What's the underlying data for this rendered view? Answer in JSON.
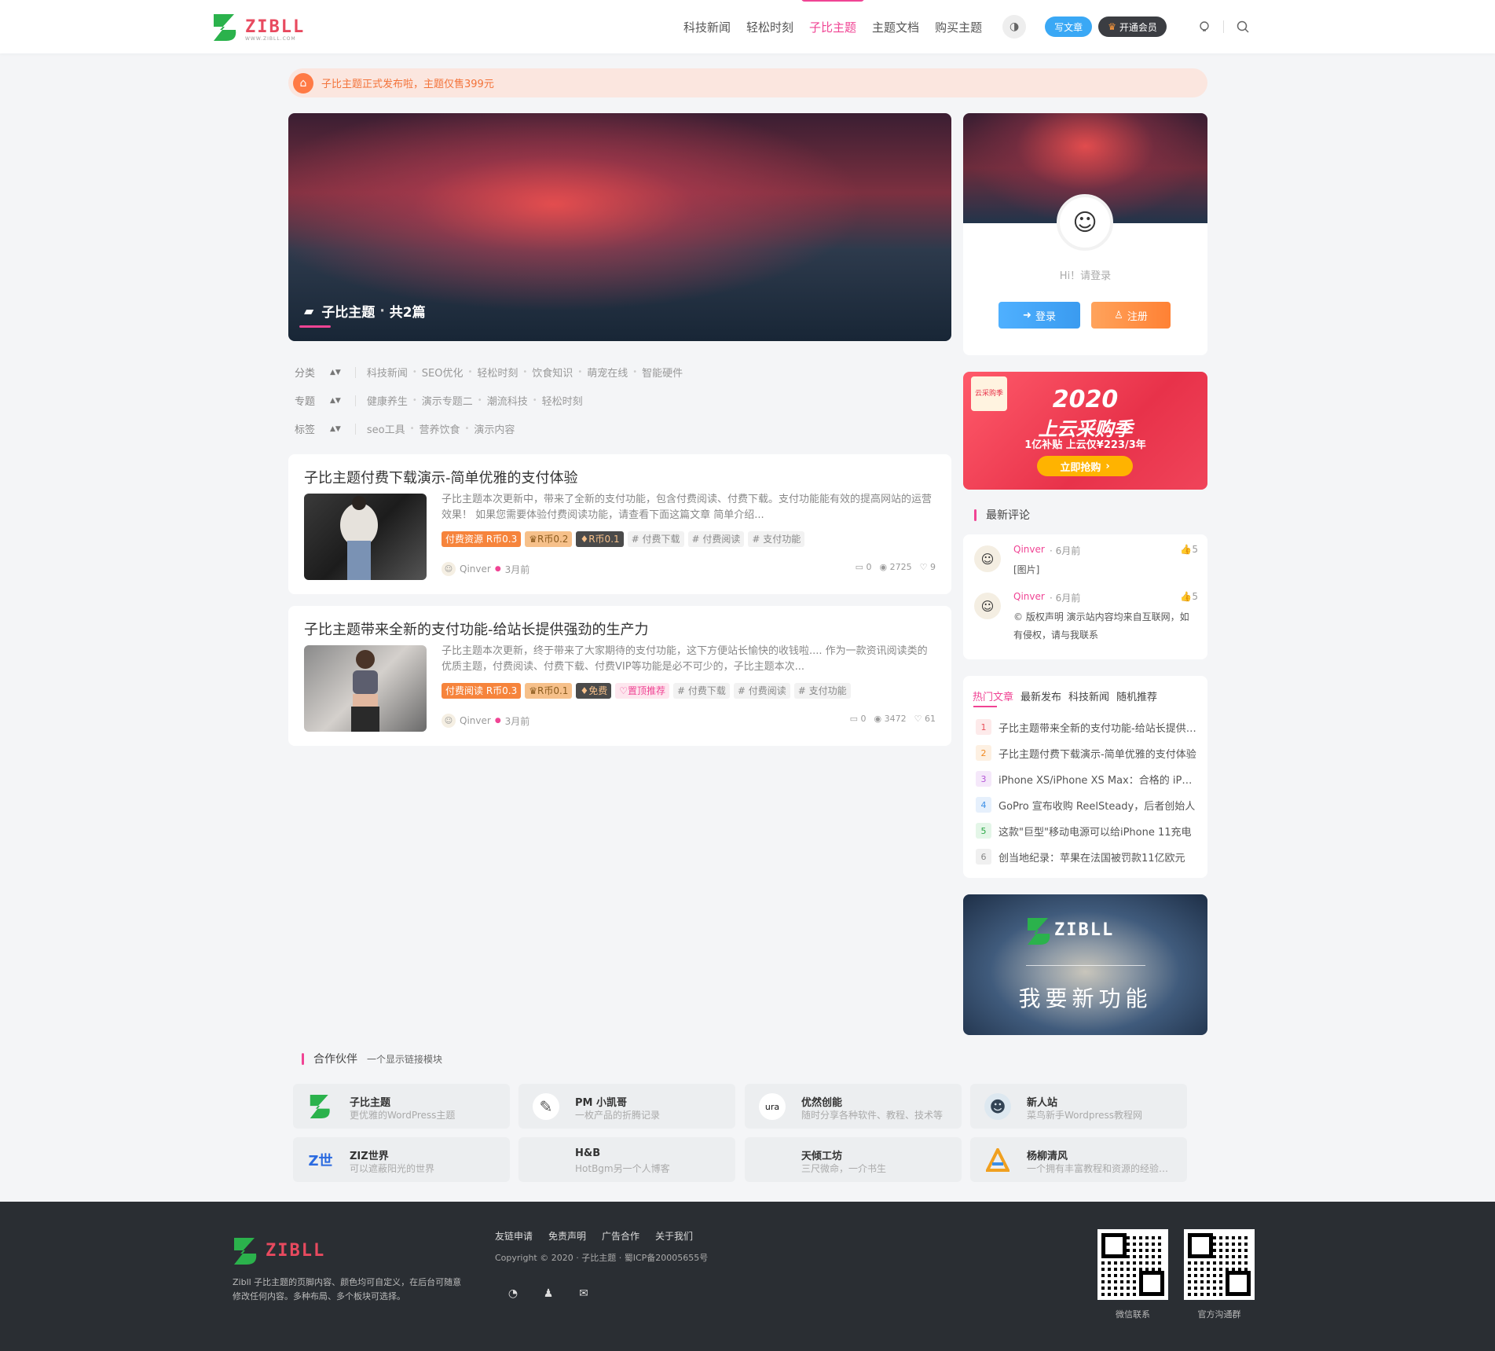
{
  "header": {
    "logo_text": "ZIBLL",
    "logo_sub": "WWW.ZIBLL.COM",
    "nav": [
      "科技新闻",
      "轻松时刻",
      "子比主题",
      "主题文档",
      "购买主题"
    ],
    "write_label": "写文章",
    "vip_label": "开通会员"
  },
  "notice": {
    "text": "子比主题正式发布啦，主题仅售399元"
  },
  "hero": {
    "category": "子比主题",
    "count": "共2篇"
  },
  "filters": [
    {
      "label": "分类",
      "items": [
        "科技新闻",
        "SEO优化",
        "轻松时刻",
        "饮食知识",
        "萌宠在线",
        "智能硬件"
      ]
    },
    {
      "label": "专题",
      "items": [
        "健康养生",
        "演示专题二",
        "潮流科技",
        "轻松时刻"
      ]
    },
    {
      "label": "标签",
      "items": [
        "seo工具",
        "营养饮食",
        "演示内容"
      ]
    }
  ],
  "posts": [
    {
      "title": "子比主题付费下载演示-简单优雅的支付体验",
      "desc": "子比主题本次更新中，带来了全新的支付功能，包含付费阅读、付费下载。支付功能能有效的提高网站的运营效果！ 如果您需要体验付费阅读功能，请查看下面这篇文章 简单介绍...",
      "tags": [
        "付费资源 R币0.3",
        "R币0.2",
        "R币0.1",
        "# 付费下载",
        "# 付费阅读",
        "# 支付功能"
      ],
      "author": "Qinver",
      "time": "3月前",
      "comments": "0",
      "views": "2725",
      "likes": "9"
    },
    {
      "title": "子比主题带来全新的支付功能-给站长提供强劲的生产力",
      "desc": "子比主题本次更新，终于带来了大家期待的支付功能，这下方便站长愉快的收钱啦.... 作为一款资讯阅读类的优质主题，付费阅读、付费下载、付费VIP等功能是必不可少的，子比主题本次...",
      "tags": [
        "付费阅读 R币0.3",
        "R币0.1",
        "免费",
        "置顶推荐",
        "# 付费下载",
        "# 付费阅读",
        "# 支付功能"
      ],
      "author": "Qinver",
      "time": "3月前",
      "comments": "0",
      "views": "3472",
      "likes": "61"
    }
  ],
  "user_card": {
    "greeting": "Hi！请登录",
    "login": "登录",
    "register": "注册"
  },
  "ad": {
    "badge": "云采购季",
    "year": "2020",
    "title": "上云采购季",
    "sub": "1亿补贴 上云仅¥223/3年",
    "button": "立即抢购"
  },
  "comments_section": {
    "title": "最新评论",
    "items": [
      {
        "name": "Qinver",
        "time": "6月前",
        "likes": "5",
        "text": "[图片]"
      },
      {
        "name": "Qinver",
        "time": "6月前",
        "likes": "5",
        "text": "© 版权声明 演示站内容均来自互联网，如有侵权，请与我联系"
      }
    ]
  },
  "hot": {
    "tabs": [
      "热门文章",
      "最新发布",
      "科技新闻",
      "随机推荐"
    ],
    "items": [
      "子比主题带来全新的支付功能-给站长提供强劲的生产力",
      "子比主题付费下载演示-简单优雅的支付体验",
      "iPhone XS/iPhone XS Max：合格的 iPhone",
      "GoPro 宣布收购 ReelSteady，后者创始人",
      "这款\"巨型\"移动电源可以给iPhone 11充电",
      "创当地纪录：苹果在法国被罚款11亿欧元"
    ],
    "colors": [
      "#e8505b",
      "#f08a24",
      "#b556d6",
      "#3a8ee6",
      "#2aa845",
      "#888888"
    ]
  },
  "feature_banner": {
    "logo": "ZIBLL",
    "text": "我要新功能"
  },
  "partners": {
    "title": "合作伙伴",
    "subtitle": "一个显示链接模块",
    "items": [
      {
        "name": "子比主题",
        "desc": "更优雅的WordPress主题"
      },
      {
        "name": "PM 小凯哥",
        "desc": "一枚产品的折腾记录"
      },
      {
        "name": "优然创能",
        "desc": "随时分享各种软件、教程、技术等"
      },
      {
        "name": "新人站",
        "desc": "菜鸟新手Wordpress教程网"
      },
      {
        "name": "ZIZ世界",
        "desc": "可以遮蔽阳光的世界"
      },
      {
        "name": "H&B",
        "desc": "HotBgm另一个人博客"
      },
      {
        "name": "天倾工坊",
        "desc": "三尺微命，一介书生"
      },
      {
        "name": "杨柳清风",
        "desc": "一个拥有丰富教程和资源的经验分享"
      }
    ]
  },
  "footer": {
    "desc": "Zibll 子比主题的页脚内容、颜色均可自定义，在后台可随意修改任何内容。多种布局、多个板块可选择。",
    "links": [
      "友链申请",
      "免责声明",
      "广告合作",
      "关于我们"
    ],
    "copyright": "Copyright © 2020 · 子比主题 · 蜀ICP备20005655号",
    "qr1": "微信联系",
    "qr2": "官方沟通群"
  }
}
